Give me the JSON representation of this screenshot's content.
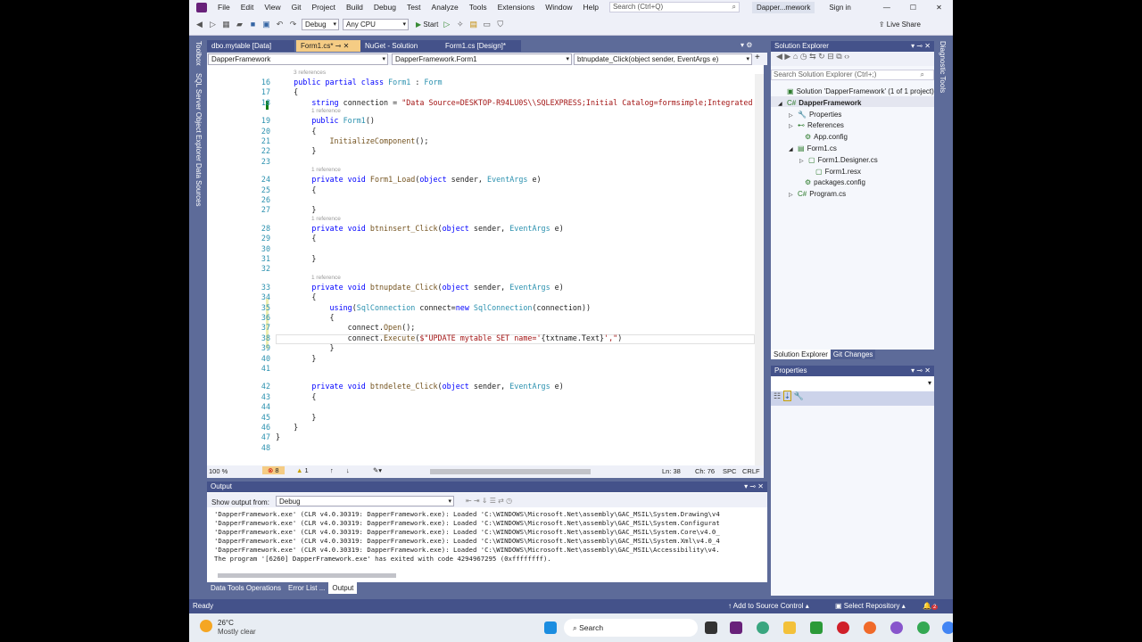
{
  "menu": [
    "File",
    "Edit",
    "View",
    "Git",
    "Project",
    "Build",
    "Debug",
    "Test",
    "Analyze",
    "Tools",
    "Extensions",
    "Window",
    "Help"
  ],
  "search_placeholder": "Search (Ctrl+Q)",
  "solution_name": "Dapper...mework",
  "sign_in": "Sign in",
  "toolbar": {
    "config": "Debug",
    "platform": "Any CPU",
    "start": "Start",
    "live_share": "Live Share"
  },
  "tabs": [
    {
      "label": "dbo.mytable [Data]"
    },
    {
      "label": "Form1.cs*"
    },
    {
      "label": "NuGet - Solution"
    },
    {
      "label": "Form1.cs [Design]*"
    }
  ],
  "left_strip": [
    "Toolbox",
    "SQL Server Object Explorer",
    "Data Sources"
  ],
  "right_strip": "Diagnostic Tools",
  "navbar": {
    "project": "DapperFramework",
    "class": "DapperFramework.Form1",
    "member": "btnupdate_Click(object sender, EventArgs e)"
  },
  "code": [
    {
      "ref": "3 references"
    },
    {
      "n": "16",
      "t": [
        [
          "    "
        ],
        [
          "public partial class ",
          "kw"
        ],
        [
          "Form1",
          "ty"
        ],
        [
          " : "
        ],
        [
          "Form",
          "ty"
        ]
      ]
    },
    {
      "n": "17",
      "t": [
        [
          "    {"
        ]
      ]
    },
    {
      "n": "18",
      "t": [
        [
          "        "
        ],
        [
          "string",
          "kw"
        ],
        [
          " connection = "
        ],
        [
          "\"Data Source=DESKTOP-R94LU0S\\\\SQLEXPRESS;Initial Catalog=formsimple;Integrated",
          "st"
        ]
      ]
    },
    {
      "ref": "1 reference"
    },
    {
      "n": "19",
      "t": [
        [
          "        "
        ],
        [
          "public ",
          "kw"
        ],
        [
          "Form1",
          "ty"
        ],
        [
          "()"
        ]
      ]
    },
    {
      "n": "20",
      "t": [
        [
          "        {"
        ]
      ]
    },
    {
      "n": "21",
      "t": [
        [
          "            "
        ],
        [
          "InitializeComponent",
          "me"
        ],
        [
          "();"
        ]
      ]
    },
    {
      "n": "22",
      "t": [
        [
          "        }"
        ]
      ]
    },
    {
      "n": "23",
      "t": [
        [
          ""
        ]
      ]
    },
    {
      "ref": "1 reference"
    },
    {
      "n": "24",
      "t": [
        [
          "        "
        ],
        [
          "private void ",
          "kw"
        ],
        [
          "Form1_Load",
          "me"
        ],
        [
          "("
        ],
        [
          "object",
          "kw"
        ],
        [
          " sender, "
        ],
        [
          "EventArgs",
          "ty"
        ],
        [
          " e)"
        ]
      ]
    },
    {
      "n": "25",
      "t": [
        [
          "        {"
        ]
      ]
    },
    {
      "n": "26",
      "t": [
        [
          ""
        ]
      ]
    },
    {
      "n": "27",
      "t": [
        [
          "        }"
        ]
      ]
    },
    {
      "ref": "1 reference"
    },
    {
      "n": "28",
      "t": [
        [
          "        "
        ],
        [
          "private void ",
          "kw"
        ],
        [
          "btninsert_Click",
          "me"
        ],
        [
          "("
        ],
        [
          "object",
          "kw"
        ],
        [
          " sender, "
        ],
        [
          "EventArgs",
          "ty"
        ],
        [
          " e)"
        ]
      ]
    },
    {
      "n": "29",
      "t": [
        [
          "        {"
        ]
      ]
    },
    {
      "n": "30",
      "t": [
        [
          ""
        ]
      ]
    },
    {
      "n": "31",
      "t": [
        [
          "        }"
        ]
      ]
    },
    {
      "n": "32",
      "t": [
        [
          ""
        ]
      ]
    },
    {
      "ref": "1 reference"
    },
    {
      "n": "33",
      "t": [
        [
          "        "
        ],
        [
          "private void ",
          "kw"
        ],
        [
          "btnupdate_Click",
          "me"
        ],
        [
          "("
        ],
        [
          "object",
          "kw"
        ],
        [
          " sender, "
        ],
        [
          "EventArgs",
          "ty"
        ],
        [
          " e)"
        ]
      ]
    },
    {
      "n": "34",
      "t": [
        [
          "        {"
        ]
      ]
    },
    {
      "n": "35",
      "t": [
        [
          "            "
        ],
        [
          "using",
          "kw"
        ],
        [
          "("
        ],
        [
          "SqlConnection",
          "ty"
        ],
        [
          " connect="
        ],
        [
          "new",
          "kw"
        ],
        [
          " "
        ],
        [
          "SqlConnection",
          "ty"
        ],
        [
          "(connection))"
        ]
      ]
    },
    {
      "n": "36",
      "t": [
        [
          "            {"
        ]
      ]
    },
    {
      "n": "37",
      "t": [
        [
          "                connect."
        ],
        [
          "Open",
          "me"
        ],
        [
          "();"
        ]
      ]
    },
    {
      "n": "38",
      "t": [
        [
          "                connect."
        ],
        [
          "Execute",
          "me"
        ],
        [
          "("
        ],
        [
          "$\"UPDATE mytable SET name='",
          "st"
        ],
        [
          "{txtname.Text}"
        ],
        [
          "',\"",
          "st"
        ],
        [
          ")"
        ]
      ]
    },
    {
      "n": "39",
      "t": [
        [
          "            }"
        ]
      ]
    },
    {
      "n": "40",
      "t": [
        [
          "        }"
        ]
      ]
    },
    {
      "n": "41",
      "t": [
        [
          ""
        ]
      ]
    },
    {
      "ref": ""
    },
    {
      "n": "42",
      "t": [
        [
          "        "
        ],
        [
          "private void ",
          "kw"
        ],
        [
          "btndelete_Click",
          "me"
        ],
        [
          "("
        ],
        [
          "object",
          "kw"
        ],
        [
          " sender, "
        ],
        [
          "EventArgs",
          "ty"
        ],
        [
          " e)"
        ]
      ]
    },
    {
      "n": "43",
      "t": [
        [
          "        {"
        ]
      ]
    },
    {
      "n": "44",
      "t": [
        [
          ""
        ]
      ]
    },
    {
      "n": "45",
      "t": [
        [
          "        }"
        ]
      ]
    },
    {
      "n": "46",
      "t": [
        [
          "    }"
        ]
      ]
    },
    {
      "n": "47",
      "t": [
        [
          "}"
        ]
      ]
    },
    {
      "n": "48",
      "t": [
        [
          ""
        ]
      ]
    }
  ],
  "editor_status": {
    "zoom": "100 %",
    "errors": "8",
    "warnings": "1",
    "ln": "Ln: 38",
    "ch": "Ch: 76",
    "spc": "SPC",
    "eol": "CRLF"
  },
  "output": {
    "title": "Output",
    "show_from_label": "Show output from:",
    "source": "Debug",
    "lines": [
      "'DapperFramework.exe' (CLR v4.0.30319: DapperFramework.exe): Loaded 'C:\\WINDOWS\\Microsoft.Net\\assembly\\GAC_MSIL\\System.Drawing\\v4",
      "'DapperFramework.exe' (CLR v4.0.30319: DapperFramework.exe): Loaded 'C:\\WINDOWS\\Microsoft.Net\\assembly\\GAC_MSIL\\System.Configurat",
      "'DapperFramework.exe' (CLR v4.0.30319: DapperFramework.exe): Loaded 'C:\\WINDOWS\\Microsoft.Net\\assembly\\GAC_MSIL\\System.Core\\v4.0_",
      "'DapperFramework.exe' (CLR v4.0.30319: DapperFramework.exe): Loaded 'C:\\WINDOWS\\Microsoft.Net\\assembly\\GAC_MSIL\\System.Xml\\v4.0_4",
      "'DapperFramework.exe' (CLR v4.0.30319: DapperFramework.exe): Loaded 'C:\\WINDOWS\\Microsoft.Net\\assembly\\GAC_MSIL\\Accessibility\\v4.",
      "The program '[6260] DapperFramework.exe' has exited with code 4294967295 (0xffffffff)."
    ]
  },
  "bottom_tabs": [
    "Data Tools Operations",
    "Error List ...",
    "Output"
  ],
  "solution_explorer": {
    "title": "Solution Explorer",
    "search_placeholder": "Search Solution Explorer (Ctrl+;)",
    "items": [
      "Solution 'DapperFramework' (1 of 1 project)",
      "DapperFramework",
      "Properties",
      "References",
      "App.config",
      "Form1.cs",
      "Form1.Designer.cs",
      "Form1.resx",
      "packages.config",
      "Program.cs"
    ]
  },
  "side_tabs": [
    "Solution Explorer",
    "Git Changes"
  ],
  "properties": {
    "title": "Properties"
  },
  "status": {
    "ready": "Ready",
    "add_source": "Add to Source Control",
    "select_repo": "Select Repository",
    "notifications": "2"
  },
  "taskbar": {
    "temp": "26°C",
    "weather": "Mostly clear",
    "search": "Search"
  }
}
